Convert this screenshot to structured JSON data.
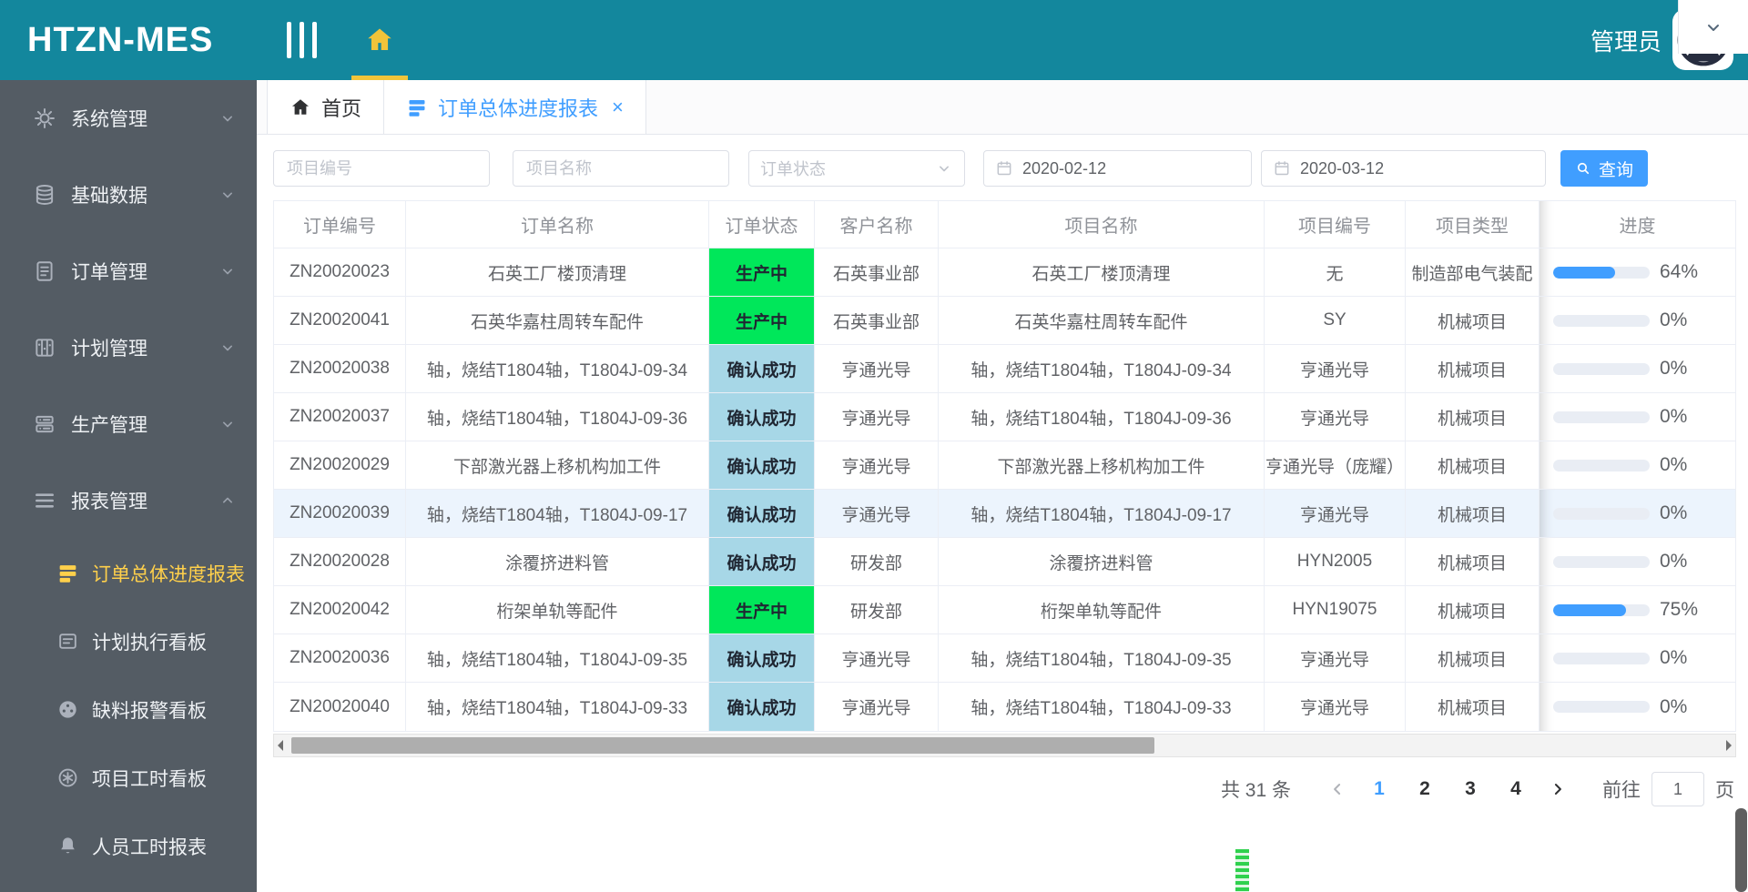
{
  "app": {
    "logo": "HTZN-MES",
    "user": "管理员"
  },
  "colors": {
    "accent": "#409eff",
    "teal_header": "#13879d",
    "sidebar_bg": "#545c64",
    "active_menu_yellow": "#ffd04b",
    "status": {
      "production": "#00e75a",
      "confirmed": "#a7d7e7"
    }
  },
  "sidebar": {
    "items": [
      {
        "id": "system",
        "label": "系统管理",
        "icon": "gear-icon",
        "expanded": false
      },
      {
        "id": "base-data",
        "label": "基础数据",
        "icon": "database-icon",
        "expanded": false
      },
      {
        "id": "order",
        "label": "订单管理",
        "icon": "order-icon",
        "expanded": false
      },
      {
        "id": "plan",
        "label": "计划管理",
        "icon": "plan-icon",
        "expanded": false
      },
      {
        "id": "production",
        "label": "生产管理",
        "icon": "production-icon",
        "expanded": false
      },
      {
        "id": "report",
        "label": "报表管理",
        "icon": "report-icon",
        "expanded": true,
        "children": [
          {
            "id": "order-progress-report",
            "label": "订单总体进度报表",
            "icon": "rows-icon",
            "active": true
          },
          {
            "id": "plan-execution-board",
            "label": "计划执行看板",
            "icon": "board-icon",
            "active": false
          },
          {
            "id": "material-alarm-board",
            "label": "缺料报警看板",
            "icon": "alarm-board-icon",
            "active": false
          },
          {
            "id": "project-hours-board",
            "label": "项目工时看板",
            "icon": "hours-board-icon",
            "active": false
          },
          {
            "id": "staff-hours-report",
            "label": "人员工时报表",
            "icon": "bell-icon",
            "active": false
          }
        ]
      }
    ]
  },
  "tabs": [
    {
      "id": "home",
      "label": "首页",
      "icon": "home-icon",
      "closable": false,
      "active": false
    },
    {
      "id": "report",
      "label": "订单总体进度报表",
      "icon": "rows-icon",
      "closable": true,
      "active": true
    }
  ],
  "filters": {
    "project_no_placeholder": "项目编号",
    "project_name_placeholder": "项目名称",
    "order_status_placeholder": "订单状态",
    "date_from": "2020-02-12",
    "date_to": "2020-03-12",
    "search_label": "查询"
  },
  "table": {
    "columns": [
      "订单编号",
      "订单名称",
      "订单状态",
      "客户名称",
      "项目名称",
      "项目编号",
      "项目类型",
      "进度"
    ],
    "rows": [
      {
        "order_no": "ZN20020023",
        "order_name": "石英工厂楼顶清理",
        "status": "生产中",
        "status_type": "production",
        "customer": "石英事业部",
        "project_name": "石英工厂楼顶清理",
        "project_no": "无",
        "project_type": "制造部电气装配",
        "progress": 64,
        "highlight": false
      },
      {
        "order_no": "ZN20020041",
        "order_name": "石英华嘉柱周转车配件",
        "status": "生产中",
        "status_type": "production",
        "customer": "石英事业部",
        "project_name": "石英华嘉柱周转车配件",
        "project_no": "SY",
        "project_type": "机械项目",
        "progress": 0,
        "highlight": false
      },
      {
        "order_no": "ZN20020038",
        "order_name": "轴，烧结T1804轴，T1804J-09-34",
        "status": "确认成功",
        "status_type": "confirmed",
        "customer": "亨通光导",
        "project_name": "轴，烧结T1804轴，T1804J-09-34",
        "project_no": "亨通光导",
        "project_type": "机械项目",
        "progress": 0,
        "highlight": false
      },
      {
        "order_no": "ZN20020037",
        "order_name": "轴，烧结T1804轴，T1804J-09-36",
        "status": "确认成功",
        "status_type": "confirmed",
        "customer": "亨通光导",
        "project_name": "轴，烧结T1804轴，T1804J-09-36",
        "project_no": "亨通光导",
        "project_type": "机械项目",
        "progress": 0,
        "highlight": false
      },
      {
        "order_no": "ZN20020029",
        "order_name": "下部激光器上移机构加工件",
        "status": "确认成功",
        "status_type": "confirmed",
        "customer": "亨通光导",
        "project_name": "下部激光器上移机构加工件",
        "project_no": "亨通光导（庞耀）",
        "project_type": "机械项目",
        "progress": 0,
        "highlight": false
      },
      {
        "order_no": "ZN20020039",
        "order_name": "轴，烧结T1804轴，T1804J-09-17",
        "status": "确认成功",
        "status_type": "confirmed",
        "customer": "亨通光导",
        "project_name": "轴，烧结T1804轴，T1804J-09-17",
        "project_no": "亨通光导",
        "project_type": "机械项目",
        "progress": 0,
        "highlight": true
      },
      {
        "order_no": "ZN20020028",
        "order_name": "涂覆挤进料管",
        "status": "确认成功",
        "status_type": "confirmed",
        "customer": "研发部",
        "project_name": "涂覆挤进料管",
        "project_no": "HYN2005",
        "project_type": "机械项目",
        "progress": 0,
        "highlight": false
      },
      {
        "order_no": "ZN20020042",
        "order_name": "桁架单轨等配件",
        "status": "生产中",
        "status_type": "production",
        "customer": "研发部",
        "project_name": "桁架单轨等配件",
        "project_no": "HYN19075",
        "project_type": "机械项目",
        "progress": 75,
        "highlight": false
      },
      {
        "order_no": "ZN20020036",
        "order_name": "轴，烧结T1804轴，T1804J-09-35",
        "status": "确认成功",
        "status_type": "confirmed",
        "customer": "亨通光导",
        "project_name": "轴，烧结T1804轴，T1804J-09-35",
        "project_no": "亨通光导",
        "project_type": "机械项目",
        "progress": 0,
        "highlight": false
      },
      {
        "order_no": "ZN20020040",
        "order_name": "轴，烧结T1804轴，T1804J-09-33",
        "status": "确认成功",
        "status_type": "confirmed",
        "customer": "亨通光导",
        "project_name": "轴，烧结T1804轴，T1804J-09-33",
        "project_no": "亨通光导",
        "project_type": "机械项目",
        "progress": 0,
        "highlight": false
      }
    ]
  },
  "pagination": {
    "total_text": "共 31 条",
    "pages": [
      "1",
      "2",
      "3",
      "4"
    ],
    "active_page": "1",
    "goto_label": "前往",
    "goto_value": "1",
    "page_label": "页"
  }
}
